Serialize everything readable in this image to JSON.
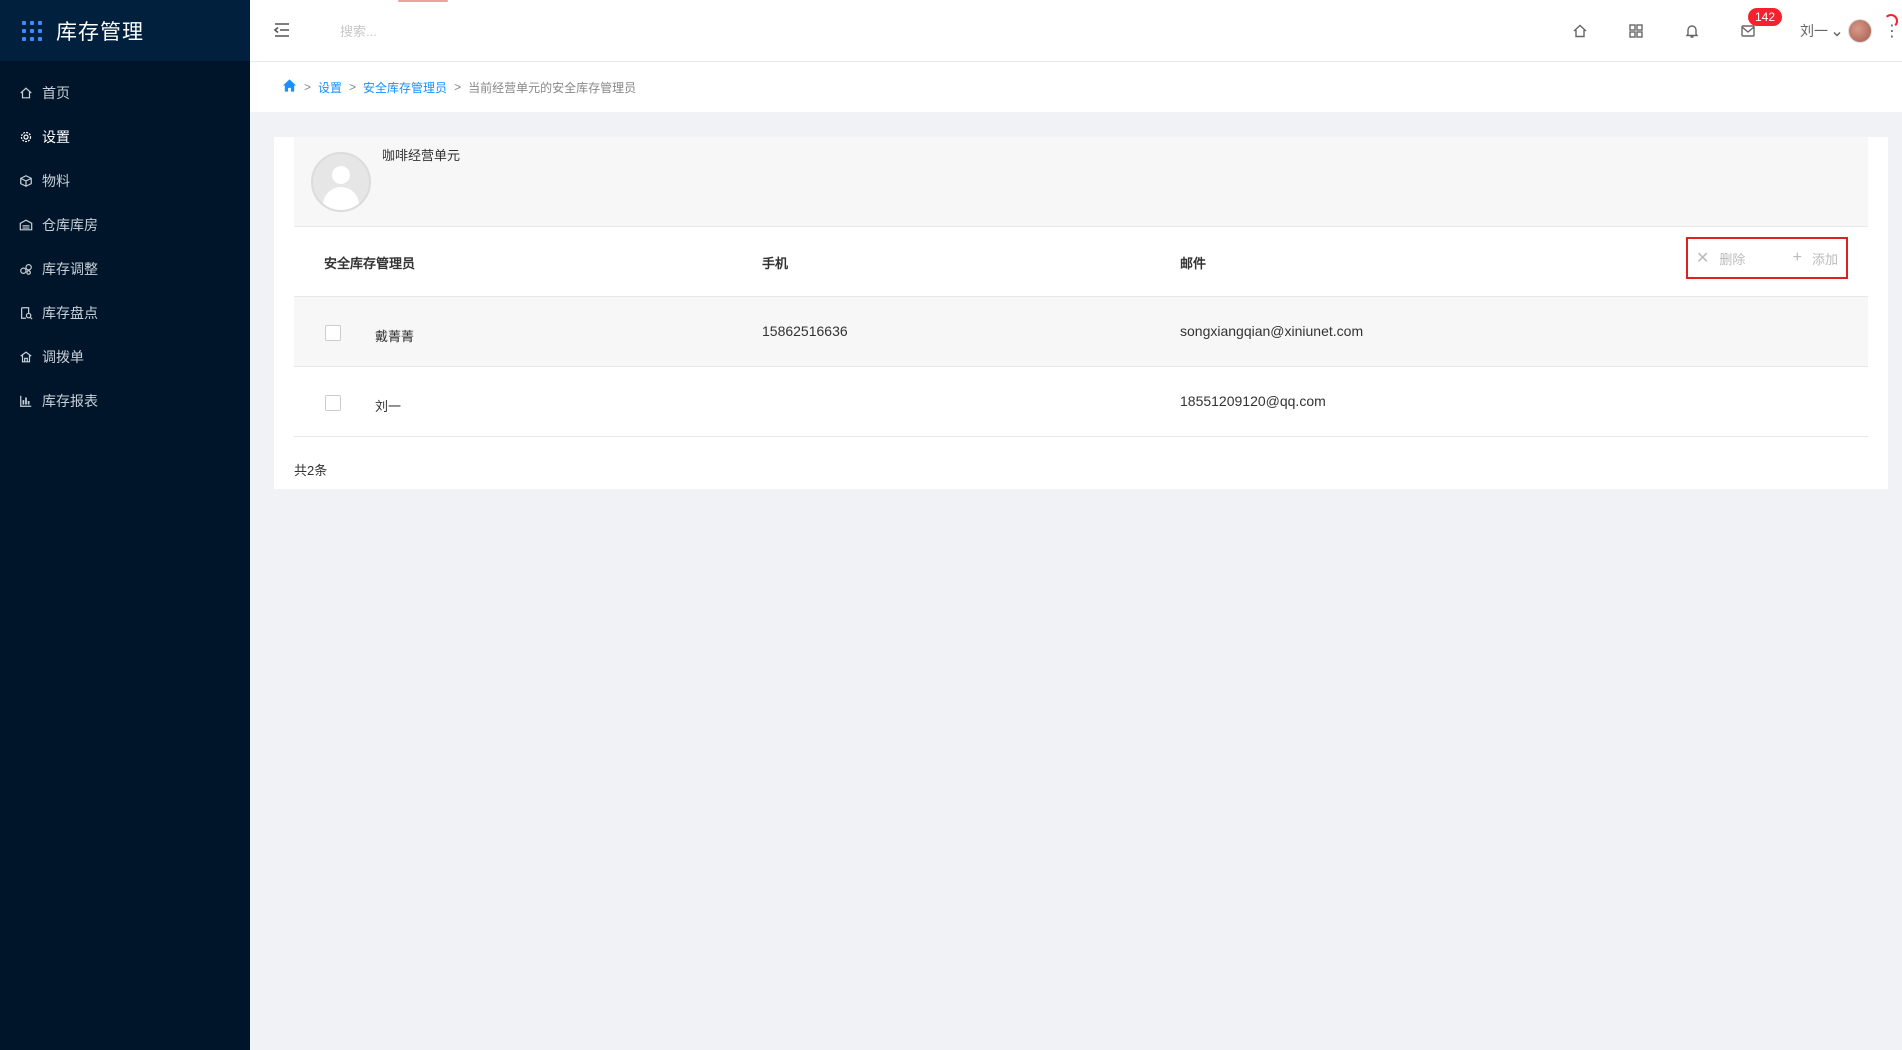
{
  "app": {
    "title": "库存管理"
  },
  "sidebar": {
    "items": [
      {
        "label": "首页",
        "icon": "home-icon"
      },
      {
        "label": "设置",
        "icon": "gear-icon",
        "active": true
      },
      {
        "label": "物料",
        "icon": "box-icon"
      },
      {
        "label": "仓库库房",
        "icon": "warehouse-icon"
      },
      {
        "label": "库存调整",
        "icon": "adjust-icon"
      },
      {
        "label": "库存盘点",
        "icon": "inventory-check-icon"
      },
      {
        "label": "调拨单",
        "icon": "transfer-icon"
      },
      {
        "label": "库存报表",
        "icon": "bar-chart-icon"
      }
    ]
  },
  "header": {
    "search_placeholder": "搜索...",
    "message_badge": "142",
    "username": "刘一"
  },
  "breadcrumb": {
    "items": [
      "设置",
      "安全库存管理员"
    ],
    "current": "当前经营单元的安全库存管理员"
  },
  "unit": {
    "name": "咖啡经营单元"
  },
  "table": {
    "columns": [
      "安全库存管理员",
      "手机",
      "邮件"
    ],
    "actions": {
      "delete": "删除",
      "add": "添加"
    },
    "rows": [
      {
        "name": "戴菁菁",
        "phone": "15862516636",
        "email": "songxiangqian@xiniunet.com"
      },
      {
        "name": "刘一",
        "phone": "",
        "email": "18551209120@qq.com"
      }
    ],
    "total": "共2条"
  },
  "colors": {
    "sidebar_bg": "#001529",
    "accent": "#1890ff",
    "badge": "#f5222d",
    "highlight_border": "#e02020"
  }
}
